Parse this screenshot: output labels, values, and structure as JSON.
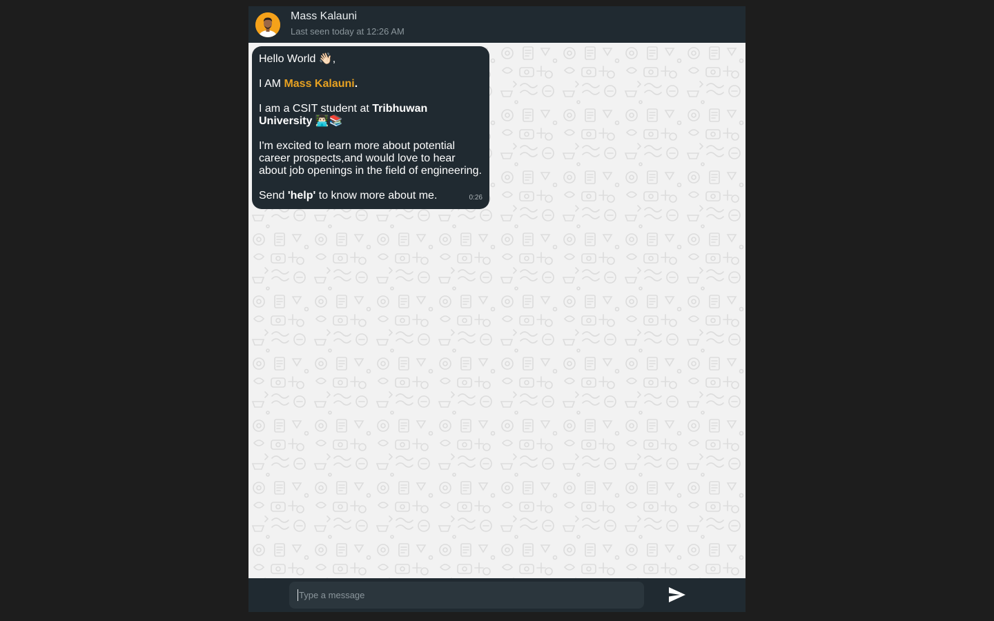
{
  "header": {
    "contact_name": "Mass Kalauni",
    "last_seen": "Last seen today at 12:26 AM",
    "avatar_icon": "user-avatar-icon"
  },
  "message": {
    "line1_text": "Hello World ",
    "line1_emoji": "👋🏻",
    "line1_suffix": ",",
    "line2_prefix": "I AM ",
    "line2_name": "Mass Kalauni",
    "line2_suffix": ".",
    "line3_prefix": "I am a CSIT student at ",
    "line3_university": "Tribhuwan University",
    "line3_emojis": " 👨🏻‍💻📚",
    "line4_text": "I'm excited to learn more about potential career prospects,and would love to hear about job openings in the field of engineering.",
    "line5_prefix": "Send ",
    "line5_keyword": "'help'",
    "line5_suffix": " to know more about me.",
    "time": "0:26"
  },
  "composer": {
    "placeholder": "Type a message",
    "send_icon": "send-icon"
  },
  "colors": {
    "header_bg": "#202a31",
    "bubble_bg": "#202a31",
    "accent": "#e8a221",
    "page_bg": "#1d1d1d",
    "chat_bg": "#efefef"
  }
}
